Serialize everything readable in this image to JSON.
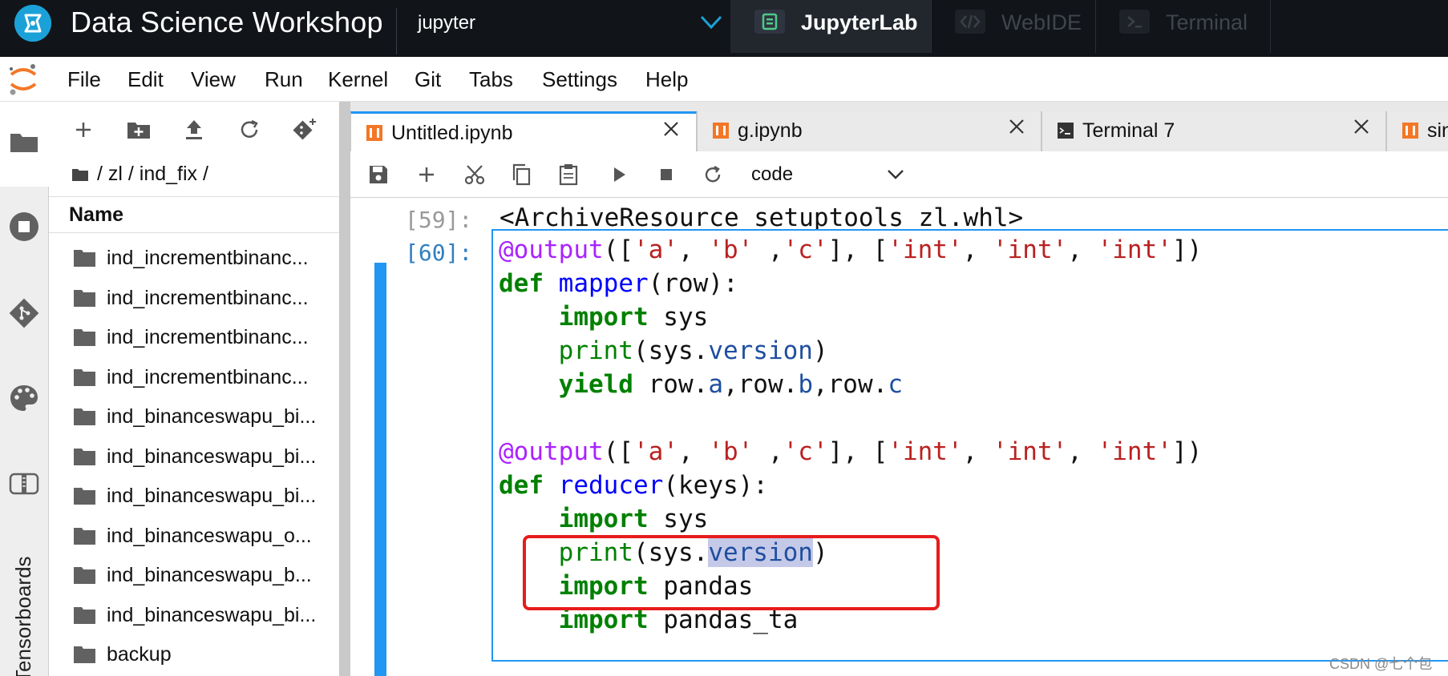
{
  "topbar": {
    "app_title": "Data Science Workshop",
    "environment": "jupyter",
    "tabs": [
      {
        "label": "JupyterLab",
        "icon": "jupyterlab-icon",
        "active": true
      },
      {
        "label": "WebIDE",
        "icon": "code-brackets-icon",
        "active": false
      },
      {
        "label": "Terminal",
        "icon": "terminal-prompt-icon",
        "active": false
      }
    ]
  },
  "menu": {
    "items": [
      "File",
      "Edit",
      "View",
      "Run",
      "Kernel",
      "Git",
      "Tabs",
      "Settings",
      "Help"
    ]
  },
  "activitybar": {
    "items": [
      "folder-icon",
      "stop-circle-icon",
      "git-icon",
      "palette-icon",
      "extension-icon"
    ],
    "vertical_label": "Tensorboards"
  },
  "filebrowser": {
    "tools": [
      "new-launcher-icon",
      "new-folder-icon",
      "upload-icon",
      "refresh-icon",
      "git-clone-icon"
    ],
    "breadcrumb": "/ zl / ind_fix /",
    "column_header": "Name",
    "files": [
      "ind_incrementbinanc...",
      "ind_incrementbinanc...",
      "ind_incrementbinanc...",
      "ind_incrementbinanc...",
      "ind_binanceswapu_bi...",
      "ind_binanceswapu_bi...",
      "ind_binanceswapu_bi...",
      "ind_binanceswapu_o...",
      "ind_binanceswapu_b...",
      "ind_binanceswapu_bi...",
      "backup"
    ]
  },
  "doctabs": [
    {
      "label": "Untitled.ipynb",
      "active": true
    },
    {
      "label": "g.ipynb",
      "active": false
    },
    {
      "label": "Terminal 7",
      "active": false
    },
    {
      "label": "sin",
      "active": false
    }
  ],
  "nbtoolbar": {
    "tools": [
      "save-icon",
      "add-cell-icon",
      "cut-icon",
      "copy-icon",
      "paste-icon",
      "run-icon",
      "stop-icon",
      "restart-icon"
    ],
    "cell_type": "code"
  },
  "notebook": {
    "out_prompt": "[59]:",
    "out_text": "<ArchiveResource setuptools_zl.whl>",
    "in_prompt": "[60]:",
    "code": {
      "l1": {
        "dec": "@output",
        "p1": "([",
        "s1": "'a'",
        "p2": ", ",
        "s2": "'b'",
        "p3": " ,",
        "s3": "'c'",
        "p4": "], [",
        "s4": "'int'",
        "p5": ", ",
        "s5": "'int'",
        "p6": ", ",
        "s6": "'int'",
        "p7": "])"
      },
      "l2": {
        "kw": "def",
        "fn": "mapper",
        "rest": "(row):"
      },
      "l3": {
        "kw": "import",
        "rest": " sys"
      },
      "l4": {
        "bi": "print",
        "p1": "(sys.",
        "attr": "version",
        "p2": ")"
      },
      "l5": {
        "kw": "yield",
        "p1": " row.",
        "a1": "a",
        "p2": ",row.",
        "a2": "b",
        "p3": ",row.",
        "a3": "c"
      },
      "l7": {
        "dec": "@output",
        "p1": "([",
        "s1": "'a'",
        "p2": ", ",
        "s2": "'b'",
        "p3": " ,",
        "s3": "'c'",
        "p4": "], [",
        "s4": "'int'",
        "p5": ", ",
        "s5": "'int'",
        "p6": ", ",
        "s6": "'int'",
        "p7": "])"
      },
      "l8": {
        "kw": "def",
        "fn": "reducer",
        "rest": "(keys):"
      },
      "l9": {
        "kw": "import",
        "rest": " sys"
      },
      "l10": {
        "bi": "print",
        "p1": "(sys.",
        "attr": "version",
        "p2": ")"
      },
      "l11": {
        "kw": "import",
        "rest": " pandas"
      },
      "l12": {
        "kw": "import",
        "rest": " pandas_ta"
      }
    }
  },
  "watermark": "CSDN @七个包",
  "colors": {
    "accent": "#2196f3",
    "topbar_bg": "#111418",
    "highlight_box": "#e61c1c"
  }
}
